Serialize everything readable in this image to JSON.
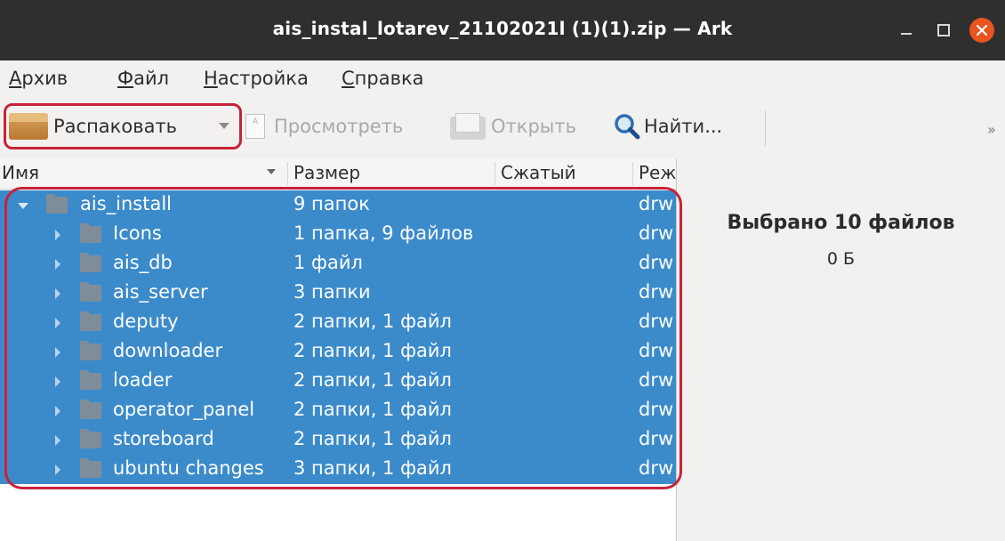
{
  "window": {
    "title": "ais_instal_lotarev_21102021l (1)(1).zip — Ark"
  },
  "menu": [
    "Архив",
    "Файл",
    "Настройка",
    "Справка"
  ],
  "toolbar": {
    "extract": "Распаковать",
    "preview": "Просмотреть",
    "open": "Открыть",
    "find": "Найти...",
    "more": "»"
  },
  "columns": [
    "Имя",
    "Размер",
    "Сжатый",
    "Реж"
  ],
  "rows": [
    {
      "name": "ais_install",
      "size": "9 папок",
      "mode": "drw"
    },
    {
      "name": "Icons",
      "size": "1 папка, 9 файлов",
      "mode": "drw"
    },
    {
      "name": "ais_db",
      "size": "1 файл",
      "mode": "drw"
    },
    {
      "name": "ais_server",
      "size": "3 папки",
      "mode": "drw"
    },
    {
      "name": "deputy",
      "size": "2 папки, 1 файл",
      "mode": "drw"
    },
    {
      "name": "downloader",
      "size": "2 папки, 1 файл",
      "mode": "drw"
    },
    {
      "name": "loader",
      "size": "2 папки, 1 файл",
      "mode": "drw"
    },
    {
      "name": "operator_panel",
      "size": "2 папки, 1 файл",
      "mode": "drw"
    },
    {
      "name": "storeboard",
      "size": "2 папки, 1 файл",
      "mode": "drw"
    },
    {
      "name": "ubuntu changes",
      "size": "3 папки, 1 файл",
      "mode": "drw"
    }
  ],
  "info": {
    "selected": "Выбрано 10 файлов",
    "size": "0 Б"
  },
  "colors": {
    "selection": "#3b8bcb",
    "annotation": "#c9223a",
    "close_button": "#e95420",
    "titlebar": "#2f2f2f"
  },
  "icons": [
    "close-icon",
    "minimize-icon",
    "maximize-icon",
    "archive-box-icon",
    "document-icon",
    "folder-open-icon",
    "magnifier-icon",
    "folder-icon",
    "expand-arrow-icon"
  ]
}
